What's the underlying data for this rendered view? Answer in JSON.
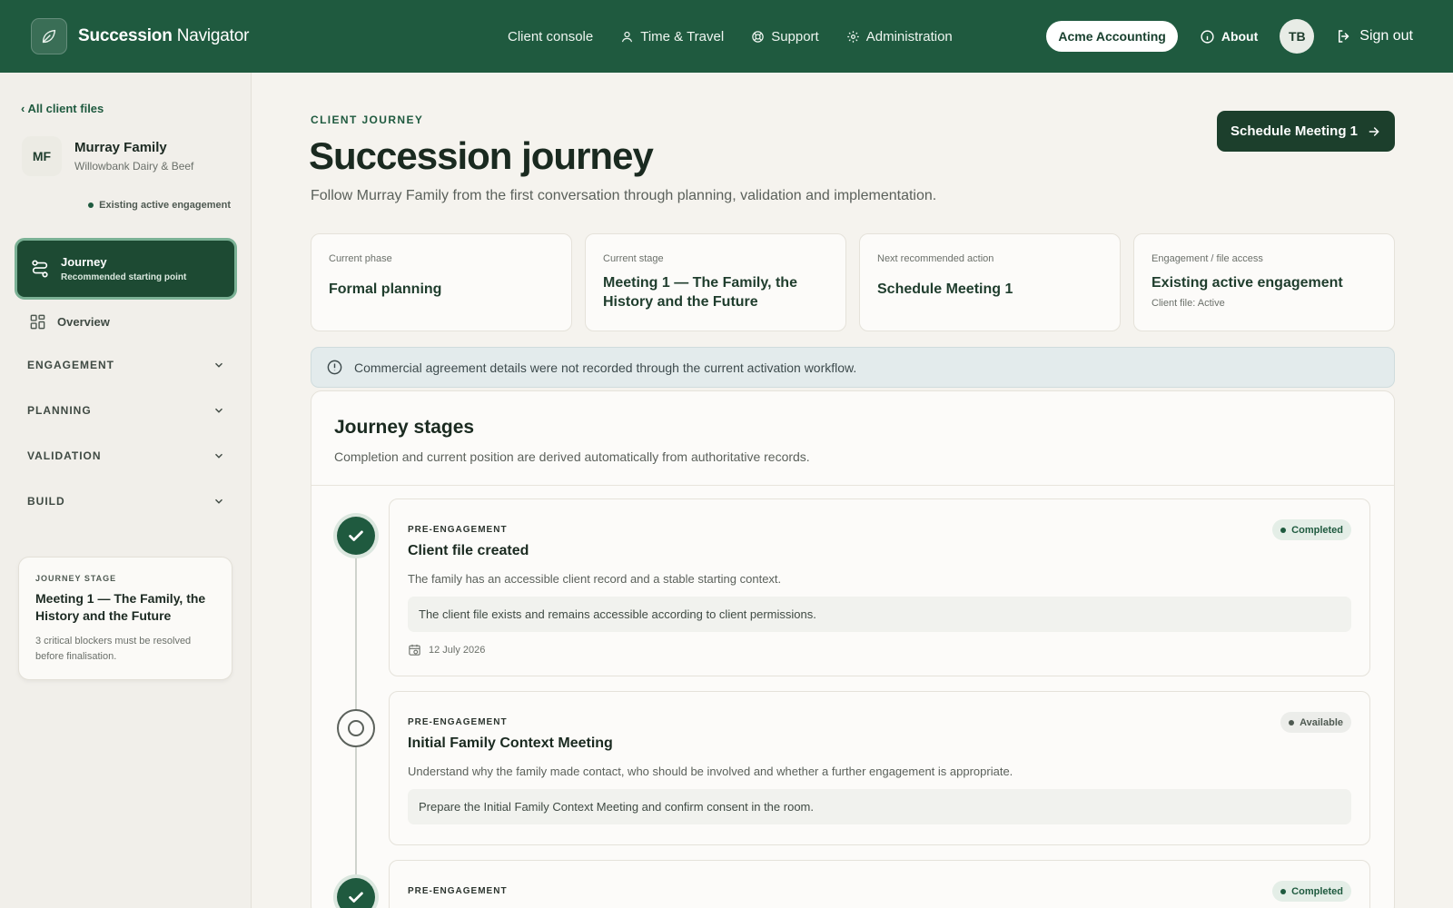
{
  "app": {
    "brand_bold": "Succession",
    "brand_rest": " Navigator",
    "nav": [
      {
        "label": "Client console",
        "icon": "none"
      },
      {
        "label": "Time & Travel",
        "icon": "person-icon"
      },
      {
        "label": "Support",
        "icon": "lifebuoy-icon"
      },
      {
        "label": "Administration",
        "icon": "gear-icon"
      }
    ],
    "org": "Acme Accounting",
    "about": "About",
    "user_initials": "TB",
    "signout": "Sign out"
  },
  "sidebar": {
    "back": "‹ All client files",
    "client_initials": "MF",
    "client_name": "Murray Family",
    "client_sub": "Willowbank Dairy & Beef",
    "engagement": "Existing active engagement",
    "journey_label": "Journey",
    "journey_sub": "Recommended starting point",
    "overview": "Overview",
    "sections": [
      "ENGAGEMENT",
      "PLANNING",
      "VALIDATION",
      "BUILD"
    ],
    "stage_card": {
      "eyebrow": "JOURNEY STAGE",
      "title": "Meeting 1 — The Family, the History and the Future",
      "note": "3 critical blockers must be resolved before finalisation."
    }
  },
  "main": {
    "eyebrow": "CLIENT JOURNEY",
    "title": "Succession journey",
    "subtitle": "Follow Murray Family from the first conversation through planning, validation and implementation.",
    "cta": "Schedule Meeting 1",
    "cards": [
      {
        "label": "Current phase",
        "value": "Formal planning",
        "note": ""
      },
      {
        "label": "Current stage",
        "value": "Meeting 1 — The Family, the History and the Future",
        "note": ""
      },
      {
        "label": "Next recommended action",
        "value": "Schedule Meeting 1",
        "note": ""
      },
      {
        "label": "Engagement / file access",
        "value": "Existing active engagement",
        "note": "Client file: Active"
      }
    ],
    "alert": "Commercial agreement details were not recorded through the current activation workflow.",
    "stages_title": "Journey stages",
    "stages_sub": "Completion and current position are derived automatically from authoritative records.",
    "stages": [
      {
        "phase": "PRE-ENGAGEMENT",
        "title": "Client file created",
        "desc": "The family has an accessible client record and a stable starting context.",
        "detail": "The client file exists and remains accessible according to client permissions.",
        "date": "12 July 2026",
        "status": "Completed"
      },
      {
        "phase": "PRE-ENGAGEMENT",
        "title": "Initial Family Context Meeting",
        "desc": "Understand why the family made contact, who should be involved and whether a further engagement is appropriate.",
        "detail": "Prepare the Initial Family Context Meeting and confirm consent in the room.",
        "status": "Available"
      },
      {
        "phase": "PRE-ENGAGEMENT",
        "status": "Completed"
      }
    ]
  },
  "colors": {
    "brand_green": "#1f5a3f",
    "dark_green": "#1c3f2c",
    "background": "#f5f3ee"
  }
}
